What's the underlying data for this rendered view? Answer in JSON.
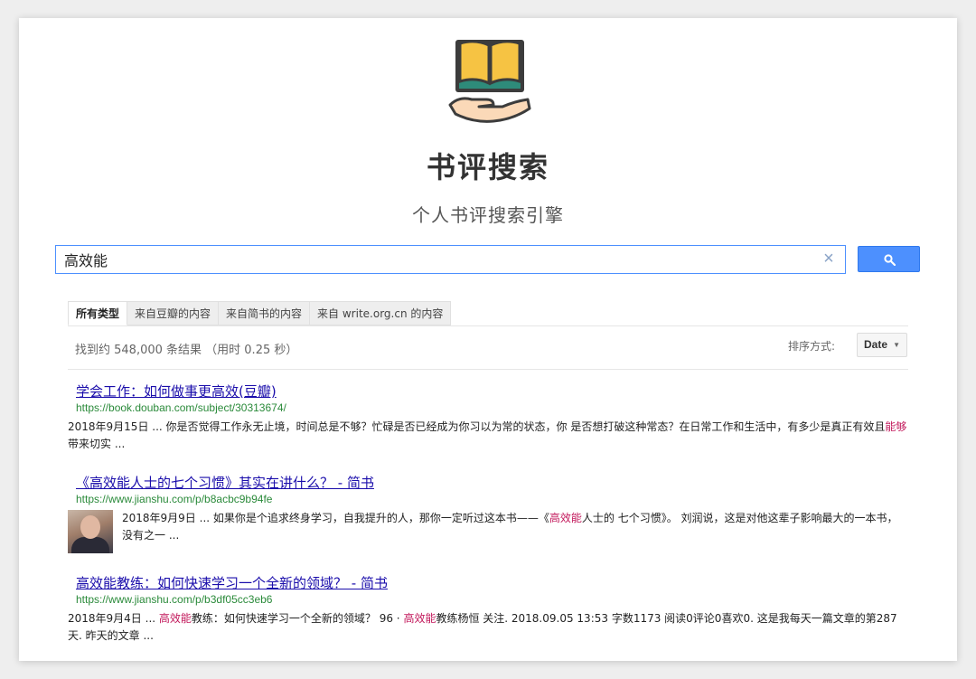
{
  "header": {
    "logo_icon": "book-in-hand-icon",
    "title": "书评搜索",
    "subtitle": "个人书评搜索引擎"
  },
  "search": {
    "query": "高效能",
    "clear_icon": "×",
    "button_icon": "search-icon",
    "accent_color": "#4d90fe"
  },
  "tabs": [
    {
      "label": "所有类型",
      "active": true
    },
    {
      "label": "来自豆瓣的内容",
      "active": false
    },
    {
      "label": "来自简书的内容",
      "active": false
    },
    {
      "label": "来自 write.org.cn 的内容",
      "active": false
    }
  ],
  "results_info": "找到约 548,000 条结果 （用时 0.25 秒）",
  "sort": {
    "label": "排序方式:",
    "selected": "Date"
  },
  "results": [
    {
      "title": "学会工作：如何做事更高效(豆瓣)",
      "url": "https://book.douban.com/subject/30313674/",
      "snippet_parts": [
        {
          "text": "2018年9月15日 ... 你是否觉得工作永无止境，时间总是不够？忙碌是否已经成为你习以为常的状态，你 是否想打破这种常态？在日常工作和生活中，有多少是真正有效且",
          "hl": false
        },
        {
          "text": "能够",
          "hl": true
        },
        {
          "text": "带来切实 ...",
          "hl": false
        }
      ]
    },
    {
      "title": "《高效能人士的七个习惯》其实在讲什么？ - 简书",
      "url": "https://www.jianshu.com/p/b8acbc9b94fe",
      "snippet_parts": [
        {
          "text": "2018年9月9日 ... 如果你是个追求终身学习，自我提升的人，那你一定听过这本书——《",
          "hl": false
        },
        {
          "text": "高效能",
          "hl": true
        },
        {
          "text": "人士的 七个习惯》。 刘润说，这是对他这辈子影响最大的一本书，没有之一 ...",
          "hl": false
        }
      ]
    },
    {
      "title": "高效能教练：如何快速学习一个全新的领域？ - 简书",
      "url": "https://www.jianshu.com/p/b3df05cc3eb6",
      "snippet_parts": [
        {
          "text": "2018年9月4日 ... ",
          "hl": false
        },
        {
          "text": "高效能",
          "hl": true
        },
        {
          "text": "教练：如何快速学习一个全新的领域？ 96 · ",
          "hl": false
        },
        {
          "text": "高效能",
          "hl": true
        },
        {
          "text": "教练杨恒 关注. 2018.09.05 13:53 字数1173 阅读0评论0喜欢0. 这是我每天一篇文章的第287天. 昨天的文章 ...",
          "hl": false
        }
      ]
    }
  ]
}
